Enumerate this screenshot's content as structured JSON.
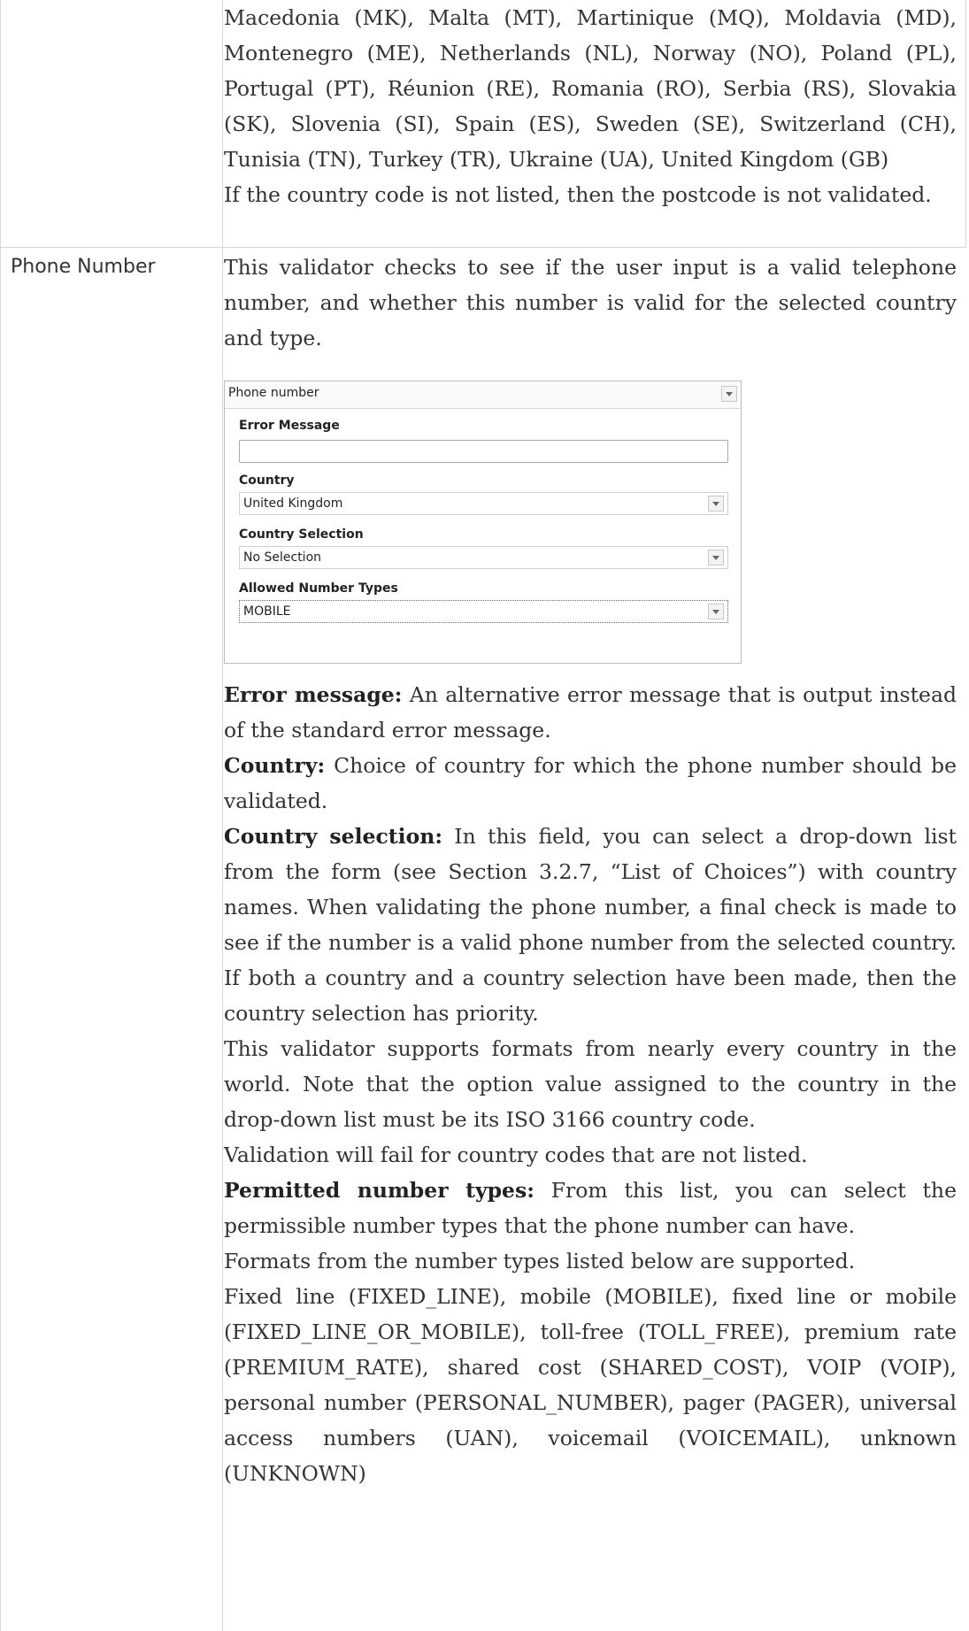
{
  "row1": {
    "countries_text": "Macedonia (MK), Malta (MT), Martinique (MQ), Moldavia (MD), Montenegro (ME), Netherlands (NL), Norway (NO), Poland (PL), Portugal (PT), Réunion (RE), Romania (RO), Serbia (RS), Slovakia (SK), Slovenia (SI), Spain (ES), Sweden (SE), Switzerland (CH), Tunisia (TN), Turkey (TR), Ukraine (UA), United Kingdom (GB)",
    "note": "If the country code is not listed, then the postcode is not validated."
  },
  "row2": {
    "label": "Phone Number",
    "intro": "This validator checks to see if the user input is a valid telephone number, and whether this number is valid for the selected country and type.",
    "widget": {
      "title": "Phone number",
      "error_message_label": "Error Message",
      "error_message_value": "",
      "country_label": "Country",
      "country_value": "United Kingdom",
      "country_selection_label": "Country Selection",
      "country_selection_value": "No Selection",
      "allowed_types_label": "Allowed Number Types",
      "allowed_types_value": "MOBILE"
    },
    "error_message_term": "Error message:",
    "error_message_desc": " An alternative error message that is output instead of the standard error message.",
    "country_term": "Country:",
    "country_desc": "  Choice of country for which the phone number should be validated.",
    "country_selection_term": "Country selection:",
    "country_selection_desc": "  In this field, you can select a drop-down list from the form (see Section 3.2.7, “List of Choices”) with country names. When validating the phone number, a final check is made to see if the number is a valid phone number from the selected country. If both a country and a country selection have been made, then the country selection has priority.",
    "formats_para": "This validator supports formats from nearly every country in the world. Note that the option value assigned to the country in the drop-down list must be its ISO 3166 country code.",
    "fail_para": "Validation will fail for country codes that are not listed.",
    "permitted_term": "Permitted number types:",
    "permitted_desc": "  From this list, you can select the permissible number types that the phone number can have.",
    "supported_para": "Formats from the number types listed below are supported.",
    "types_para": "Fixed line (FIXED_LINE), mobile (MOBILE), fixed line or mobile (FIXED_LINE_OR_MOBILE), toll-free (TOLL_FREE), premium rate (PREMIUM_RATE), shared cost (SHARED_COST), VOIP (VOIP), personal number (PERSONAL_NUMBER), pager (PAGER), universal access numbers (UAN), voicemail (VOICEMAIL), unknown (UNKNOWN)"
  }
}
